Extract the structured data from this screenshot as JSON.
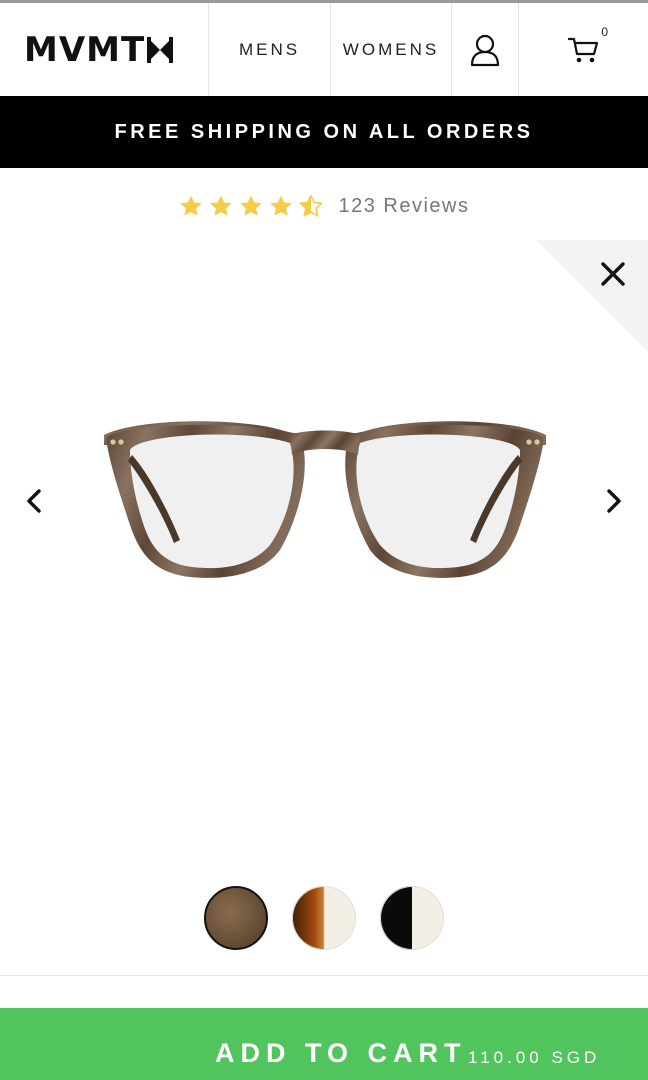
{
  "header": {
    "logo": "MVMT",
    "nav": [
      {
        "label": "MENS"
      },
      {
        "label": "WOMENS"
      }
    ],
    "account_icon": "user-icon",
    "cart_icon": "cart-icon",
    "cart_count": "0"
  },
  "banner": {
    "text": "FREE SHIPPING ON ALL ORDERS"
  },
  "rating": {
    "stars": 4.5,
    "max": 5,
    "star_color": "#f5cc45",
    "text": "123 Reviews"
  },
  "product": {
    "image_icon": "eyeglasses-image",
    "swatches": [
      {
        "name": "brown-tortoise",
        "selected": true
      },
      {
        "name": "amber-cream",
        "selected": false
      },
      {
        "name": "black-cream",
        "selected": false
      }
    ]
  },
  "cta": {
    "label": "ADD TO CART",
    "price": "110.00 SGD",
    "color": "#52c45e"
  },
  "icons": {
    "close": "close-icon",
    "prev": "chevron-left-icon",
    "next": "chevron-right-icon"
  }
}
